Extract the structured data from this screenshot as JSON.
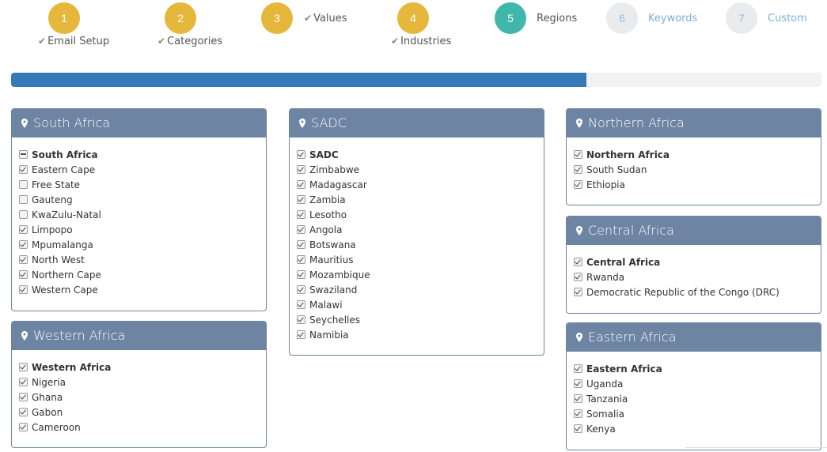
{
  "wizard": {
    "steps": [
      {
        "number": "1",
        "label": "Email Setup",
        "state": "done"
      },
      {
        "number": "2",
        "label": "Categories",
        "state": "done"
      },
      {
        "number": "3",
        "label": "Values",
        "state": "done"
      },
      {
        "number": "4",
        "label": "Industries",
        "state": "done"
      },
      {
        "number": "5",
        "label": "Regions",
        "state": "active"
      },
      {
        "number": "6",
        "label": "Keywords",
        "state": "todo"
      },
      {
        "number": "7",
        "label": "Custom",
        "state": "todo"
      }
    ],
    "progress_fraction": 0.71
  },
  "colors": {
    "done_step": "#e5b73b",
    "active_step": "#3fb7aa",
    "todo_step": "#e9ebed",
    "progress": "#337ab7",
    "panel_header": "#6d84a3"
  },
  "panels": {
    "south_africa": {
      "title": "South Africa",
      "items": [
        {
          "label": "South Africa",
          "state": "partial",
          "bold": true
        },
        {
          "label": "Eastern Cape",
          "state": "checked"
        },
        {
          "label": "Free State",
          "state": "unchecked"
        },
        {
          "label": "Gauteng",
          "state": "unchecked"
        },
        {
          "label": "KwaZulu-Natal",
          "state": "unchecked"
        },
        {
          "label": "Limpopo",
          "state": "checked"
        },
        {
          "label": "Mpumalanga",
          "state": "checked"
        },
        {
          "label": "North West",
          "state": "checked"
        },
        {
          "label": "Northern Cape",
          "state": "checked"
        },
        {
          "label": "Western Cape",
          "state": "checked"
        }
      ]
    },
    "western_africa": {
      "title": "Western Africa",
      "items": [
        {
          "label": "Western Africa",
          "state": "checked",
          "bold": true
        },
        {
          "label": "Nigeria",
          "state": "checked"
        },
        {
          "label": "Ghana",
          "state": "checked"
        },
        {
          "label": "Gabon",
          "state": "checked"
        },
        {
          "label": "Cameroon",
          "state": "checked"
        }
      ]
    },
    "sadc": {
      "title": "SADC",
      "items": [
        {
          "label": "SADC",
          "state": "checked",
          "bold": true
        },
        {
          "label": "Zimbabwe",
          "state": "checked"
        },
        {
          "label": "Madagascar",
          "state": "checked"
        },
        {
          "label": "Zambia",
          "state": "checked"
        },
        {
          "label": "Lesotho",
          "state": "checked"
        },
        {
          "label": "Angola",
          "state": "checked"
        },
        {
          "label": "Botswana",
          "state": "checked"
        },
        {
          "label": "Mauritius",
          "state": "checked"
        },
        {
          "label": "Mozambique",
          "state": "checked"
        },
        {
          "label": "Swaziland",
          "state": "checked"
        },
        {
          "label": "Malawi",
          "state": "checked"
        },
        {
          "label": "Seychelles",
          "state": "checked"
        },
        {
          "label": "Namibia",
          "state": "checked"
        }
      ]
    },
    "northern_africa": {
      "title": "Northern Africa",
      "items": [
        {
          "label": "Northern Africa",
          "state": "checked",
          "bold": true
        },
        {
          "label": "South Sudan",
          "state": "checked"
        },
        {
          "label": "Ethiopia",
          "state": "checked"
        }
      ]
    },
    "central_africa": {
      "title": "Central Africa",
      "items": [
        {
          "label": "Central Africa",
          "state": "checked",
          "bold": true
        },
        {
          "label": "Rwanda",
          "state": "checked"
        },
        {
          "label": "Democratic Republic of the Congo (DRC)",
          "state": "checked"
        }
      ]
    },
    "eastern_africa": {
      "title": "Eastern Africa",
      "items": [
        {
          "label": "Eastern Africa",
          "state": "checked",
          "bold": true
        },
        {
          "label": "Uganda",
          "state": "checked"
        },
        {
          "label": "Tanzania",
          "state": "checked"
        },
        {
          "label": "Somalia",
          "state": "checked"
        },
        {
          "label": "Kenya",
          "state": "checked"
        }
      ]
    }
  }
}
